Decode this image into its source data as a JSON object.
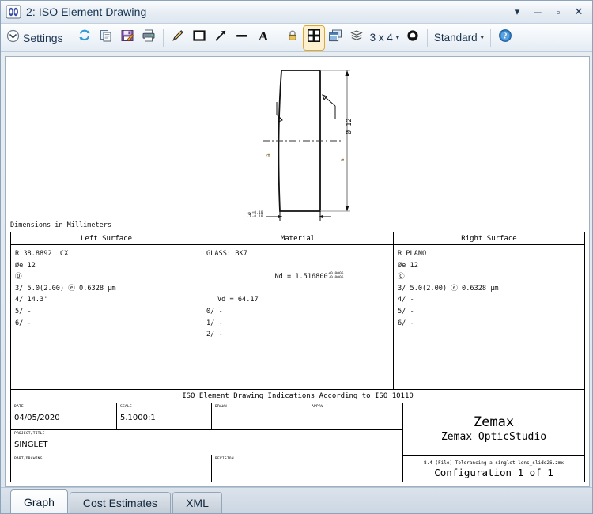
{
  "window": {
    "title": "2: ISO Element Drawing",
    "icon": "zemax-logo-icon",
    "buttons": {
      "menu": "▾",
      "minimize": "─",
      "maximize": "▫",
      "close": "✕"
    }
  },
  "toolbar": {
    "settings_label": "Settings",
    "settings_icon": "chevron-down-circle-icon",
    "refresh_icon": "refresh-icon",
    "copy_icon": "copy-icon",
    "save_icon": "save-icon",
    "print_icon": "print-icon",
    "pencil_icon": "pencil-icon",
    "rectangle_icon": "rectangle-icon",
    "arrow_icon": "arrow-icon",
    "line_icon": "line-icon",
    "text_icon": "text-tool-icon",
    "lock_icon": "lock-icon",
    "grid_icon": "grid-layout-icon",
    "windows_icon": "cascade-windows-icon",
    "layers_icon": "layers-icon",
    "grid_size_label": "3 x 4",
    "grid_size_caret": "▾",
    "clock_icon": "clock-refresh-icon",
    "style_label": "Standard",
    "style_caret": "▾",
    "help_icon": "help-icon"
  },
  "drawing": {
    "units_note": "Dimensions in Millimeters",
    "diameter_label": "Ø 12",
    "thickness_label": "3",
    "left_callout": "a",
    "right_callout": "a"
  },
  "surfaces": {
    "columns": [
      {
        "header": "Left Surface",
        "lines": [
          {
            "text": "R 38.8892  CX",
            "indent": false
          },
          {
            "text": "Øe 12",
            "indent": false
          },
          {
            "text": "⓪",
            "indent": false
          },
          {
            "text": "3/ 5.0(2.00) ⓔ 0.6328 µm",
            "indent": false
          },
          {
            "text": "4/ 14.3'",
            "indent": false
          },
          {
            "text": "5/ -",
            "indent": false
          },
          {
            "text": "6/ -",
            "indent": false
          }
        ]
      },
      {
        "header": "Material",
        "lines": [
          {
            "text": "GLASS: BK7",
            "indent": false
          },
          {
            "text": "Nd = 1.516800",
            "indent": true,
            "tol_hi": "+0.0005",
            "tol_lo": "-0.0005"
          },
          {
            "text": "Vd = 64.17",
            "indent": true
          },
          {
            "text": "0/ -",
            "indent": false
          },
          {
            "text": "1/ -",
            "indent": false
          },
          {
            "text": "2/ -",
            "indent": false
          }
        ]
      },
      {
        "header": "Right Surface",
        "lines": [
          {
            "text": "R PLANO",
            "indent": false
          },
          {
            "text": "Øe 12",
            "indent": false
          },
          {
            "text": "⓪",
            "indent": false
          },
          {
            "text": "3/ 5.0(2.00) ⓔ 0.6328 µm",
            "indent": false
          },
          {
            "text": "4/ -",
            "indent": false
          },
          {
            "text": "5/ -",
            "indent": false
          },
          {
            "text": "6/ -",
            "indent": false
          }
        ]
      }
    ]
  },
  "iso_banner": "ISO Element Drawing Indications According to ISO 10110",
  "title_block": {
    "date_caption": "DATE",
    "date_value": "04/05/2020",
    "scale_caption": "SCALE",
    "scale_value": "5.1000:1",
    "drawn_caption": "DRAWN",
    "drawn_value": "",
    "apprv_caption": "APPRV",
    "apprv_value": "",
    "project_caption": "PROJECT/TITLE",
    "project_value": "SINGLET",
    "part_caption": "PART/DRAWING",
    "part_value": "",
    "revision_caption": "REVISION",
    "revision_value": "",
    "brand_line1": "Zemax",
    "brand_line2": "Zemax OpticStudio",
    "file_note": "8.4 (File) Tolerancing a singlet lens_slide26.zmx",
    "configuration": "Configuration 1 of 1"
  },
  "tabs": [
    {
      "label": "Graph",
      "active": true
    },
    {
      "label": "Cost Estimates",
      "active": false
    },
    {
      "label": "XML",
      "active": false
    }
  ],
  "colors": {
    "accent": "#1f6fb5",
    "highlight": "#e0a72e",
    "ink": "#000000",
    "titlebar_text": "#15314f"
  }
}
